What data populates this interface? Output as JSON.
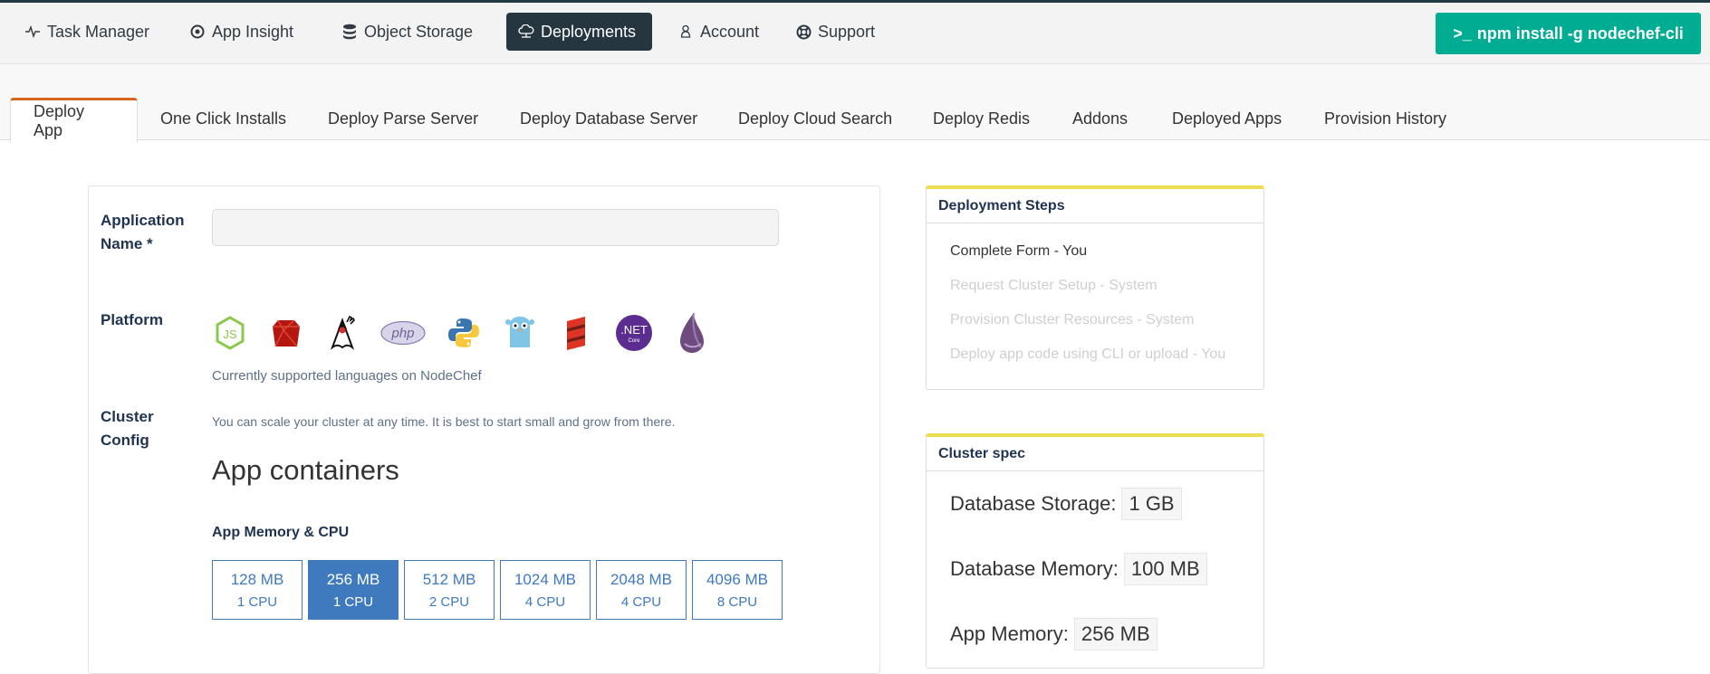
{
  "navbar": {
    "items": [
      {
        "label": "Task Manager",
        "icon": "heartbeat-icon",
        "active": false
      },
      {
        "label": "App Insight",
        "icon": "target-icon",
        "active": false
      },
      {
        "label": "Object Storage",
        "icon": "database-icon",
        "active": false
      },
      {
        "label": "Deployments",
        "icon": "cloud-icon",
        "active": true
      },
      {
        "label": "Account",
        "icon": "user-icon",
        "active": false
      },
      {
        "label": "Support",
        "icon": "lifebuoy-icon",
        "active": false
      }
    ],
    "cli_button": "npm install -g nodechef-cli",
    "cli_prompt": ">_",
    "colors": {
      "active_bg": "#263641",
      "cli_bg": "#00ad93"
    }
  },
  "tabs": [
    {
      "label": "Deploy App",
      "active": true
    },
    {
      "label": "One Click Installs",
      "active": false
    },
    {
      "label": "Deploy Parse Server",
      "active": false
    },
    {
      "label": "Deploy Database Server",
      "active": false
    },
    {
      "label": "Deploy Cloud Search",
      "active": false
    },
    {
      "label": "Deploy Redis",
      "active": false
    },
    {
      "label": "Addons",
      "active": false
    },
    {
      "label": "Deployed Apps",
      "active": false
    },
    {
      "label": "Provision History",
      "active": false
    }
  ],
  "form": {
    "app_name_label_1": "Application",
    "app_name_label_2": "Name *",
    "app_name_value": "",
    "platform_label": "Platform",
    "platforms": [
      "Node.js",
      "Ruby",
      "Java",
      "PHP",
      "Python",
      "Go",
      "Scala",
      ".NET Core",
      "Elixir"
    ],
    "net_text": ".NET",
    "net_sub": "Core",
    "php_text": "php",
    "js_text": "JS",
    "platform_help": "Currently supported languages on NodeChef",
    "cluster_label_1": "Cluster",
    "cluster_label_2": "Config",
    "cluster_help": "You can scale your cluster at any time. It is best to start small and grow from there.",
    "app_containers_heading": "App containers",
    "memory_heading": "App Memory & CPU",
    "sizes": [
      {
        "mem": "128 MB",
        "cpu": "1 CPU",
        "selected": false
      },
      {
        "mem": "256 MB",
        "cpu": "1 CPU",
        "selected": true
      },
      {
        "mem": "512 MB",
        "cpu": "2 CPU",
        "selected": false
      },
      {
        "mem": "1024 MB",
        "cpu": "4 CPU",
        "selected": false
      },
      {
        "mem": "2048 MB",
        "cpu": "4 CPU",
        "selected": false
      },
      {
        "mem": "4096 MB",
        "cpu": "8 CPU",
        "selected": false
      }
    ]
  },
  "deployment_steps": {
    "title": "Deployment Steps",
    "steps": [
      {
        "label": "Complete Form - You",
        "done": true
      },
      {
        "label": "Request Cluster Setup - System",
        "done": false
      },
      {
        "label": "Provision Cluster Resources - System",
        "done": false
      },
      {
        "label": "Deploy app code using CLI or upload - You",
        "done": false
      }
    ]
  },
  "cluster_spec": {
    "title": "Cluster spec",
    "rows": [
      {
        "label": "Database Storage:",
        "value": "1 GB"
      },
      {
        "label": "Database Memory:",
        "value": "100 MB"
      },
      {
        "label": "App Memory:",
        "value": "256 MB"
      }
    ]
  }
}
